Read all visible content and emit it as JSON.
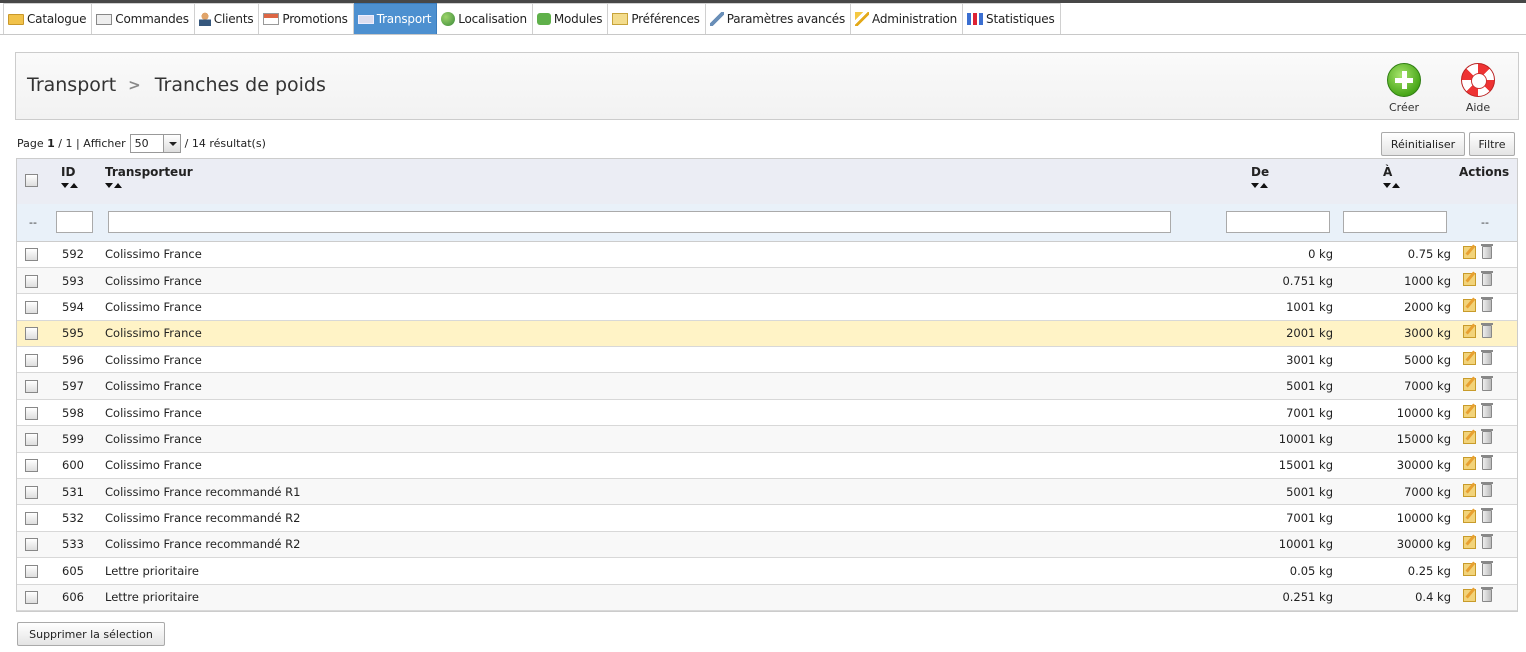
{
  "tabs": [
    {
      "label": "Catalogue",
      "icon": "folder-icon",
      "active": false
    },
    {
      "label": "Commandes",
      "icon": "cart-icon",
      "active": false
    },
    {
      "label": "Clients",
      "icon": "user-icon",
      "active": false
    },
    {
      "label": "Promotions",
      "icon": "promo-icon",
      "active": false
    },
    {
      "label": "Transport",
      "icon": "truck-icon",
      "active": true
    },
    {
      "label": "Localisation",
      "icon": "globe-icon",
      "active": false
    },
    {
      "label": "Modules",
      "icon": "puzzle-icon",
      "active": false
    },
    {
      "label": "Préférences",
      "icon": "pencil-icon",
      "active": false
    },
    {
      "label": "Paramètres avancés",
      "icon": "wrench-icon",
      "active": false
    },
    {
      "label": "Administration",
      "icon": "key-icon",
      "active": false
    },
    {
      "label": "Statistiques",
      "icon": "chart-icon",
      "active": false
    }
  ],
  "header": {
    "crumb_parent": "Transport",
    "crumb_separator": ">",
    "crumb_current": "Tranches de poids",
    "create_label": "Créer",
    "help_label": "Aide"
  },
  "pagination": {
    "page_word": "Page",
    "page_current": "1",
    "page_total": "/ 1",
    "show_label": "| Afficher",
    "per_page": "50",
    "results": "/ 14 résultat(s)"
  },
  "buttons": {
    "reset": "Réinitialiser",
    "filter": "Filtre",
    "delete_selection": "Supprimer la sélection"
  },
  "columns": {
    "id": "ID",
    "carrier": "Transporteur",
    "from": "De",
    "to": "À",
    "actions": "Actions",
    "filter_placeholder_left": "--",
    "filter_placeholder_right": "--"
  },
  "rows": [
    {
      "id": "592",
      "carrier": "Colissimo France",
      "from": "0 kg",
      "to": "0.75 kg"
    },
    {
      "id": "593",
      "carrier": "Colissimo France",
      "from": "0.751 kg",
      "to": "1000 kg"
    },
    {
      "id": "594",
      "carrier": "Colissimo France",
      "from": "1001 kg",
      "to": "2000 kg"
    },
    {
      "id": "595",
      "carrier": "Colissimo France",
      "from": "2001 kg",
      "to": "3000 kg"
    },
    {
      "id": "596",
      "carrier": "Colissimo France",
      "from": "3001 kg",
      "to": "5000 kg"
    },
    {
      "id": "597",
      "carrier": "Colissimo France",
      "from": "5001 kg",
      "to": "7000 kg"
    },
    {
      "id": "598",
      "carrier": "Colissimo France",
      "from": "7001 kg",
      "to": "10000 kg"
    },
    {
      "id": "599",
      "carrier": "Colissimo France",
      "from": "10001 kg",
      "to": "15000 kg"
    },
    {
      "id": "600",
      "carrier": "Colissimo France",
      "from": "15001 kg",
      "to": "30000 kg"
    },
    {
      "id": "531",
      "carrier": "Colissimo France recommandé R1",
      "from": "5001 kg",
      "to": "7000 kg"
    },
    {
      "id": "532",
      "carrier": "Colissimo France recommandé R2",
      "from": "7001 kg",
      "to": "10000 kg"
    },
    {
      "id": "533",
      "carrier": "Colissimo France recommandé R2",
      "from": "10001 kg",
      "to": "30000 kg"
    },
    {
      "id": "605",
      "carrier": "Lettre prioritaire",
      "from": "0.05 kg",
      "to": "0.25 kg"
    },
    {
      "id": "606",
      "carrier": "Lettre prioritaire",
      "from": "0.251 kg",
      "to": "0.4 kg"
    }
  ],
  "highlight_row": "595",
  "colors": {
    "active_tab": "#4d90d0",
    "highlight_row": "#fff3c6",
    "header_bg": "#ebedf4",
    "filter_bg": "#e9f1f9"
  }
}
